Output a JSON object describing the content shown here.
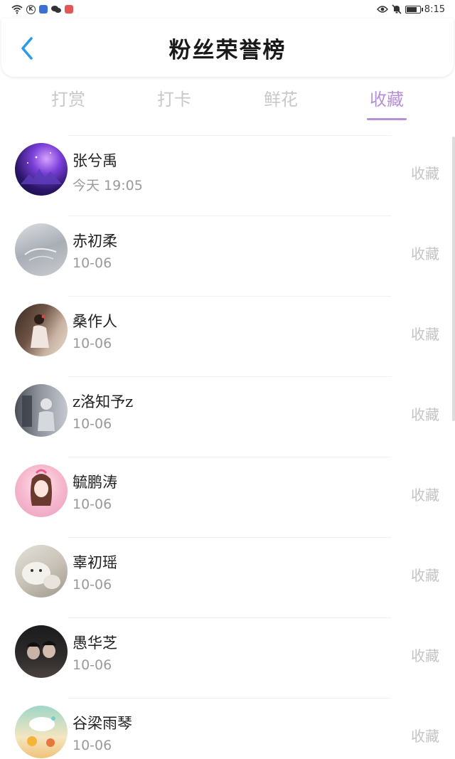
{
  "status_bar": {
    "time": "8:15",
    "colors": {
      "app_square_1": "#3b6fd6",
      "app_square_2": "#e45656"
    }
  },
  "header": {
    "title": "粉丝荣誉榜",
    "back_icon": "chevron-left-icon"
  },
  "colors": {
    "accent": "#b690d8",
    "back": "#2a9be8"
  },
  "tabs": [
    {
      "label": "打赏",
      "active": false
    },
    {
      "label": "打卡",
      "active": false
    },
    {
      "label": "鲜花",
      "active": false
    },
    {
      "label": "收藏",
      "active": true
    }
  ],
  "fans": [
    {
      "name": "张兮禹",
      "date": "今天 19:05",
      "action": "收藏"
    },
    {
      "name": "赤初柔",
      "date": "10-06",
      "action": "收藏"
    },
    {
      "name": "桑作人",
      "date": "10-06",
      "action": "收藏"
    },
    {
      "name": "z洛知予z",
      "date": "10-06",
      "action": "收藏"
    },
    {
      "name": "毓鹏涛",
      "date": "10-06",
      "action": "收藏"
    },
    {
      "name": "辜初瑶",
      "date": "10-06",
      "action": "收藏"
    },
    {
      "name": "愚华芝",
      "date": "10-06",
      "action": "收藏"
    },
    {
      "name": "谷梁雨琴",
      "date": "10-06",
      "action": "收藏"
    }
  ]
}
